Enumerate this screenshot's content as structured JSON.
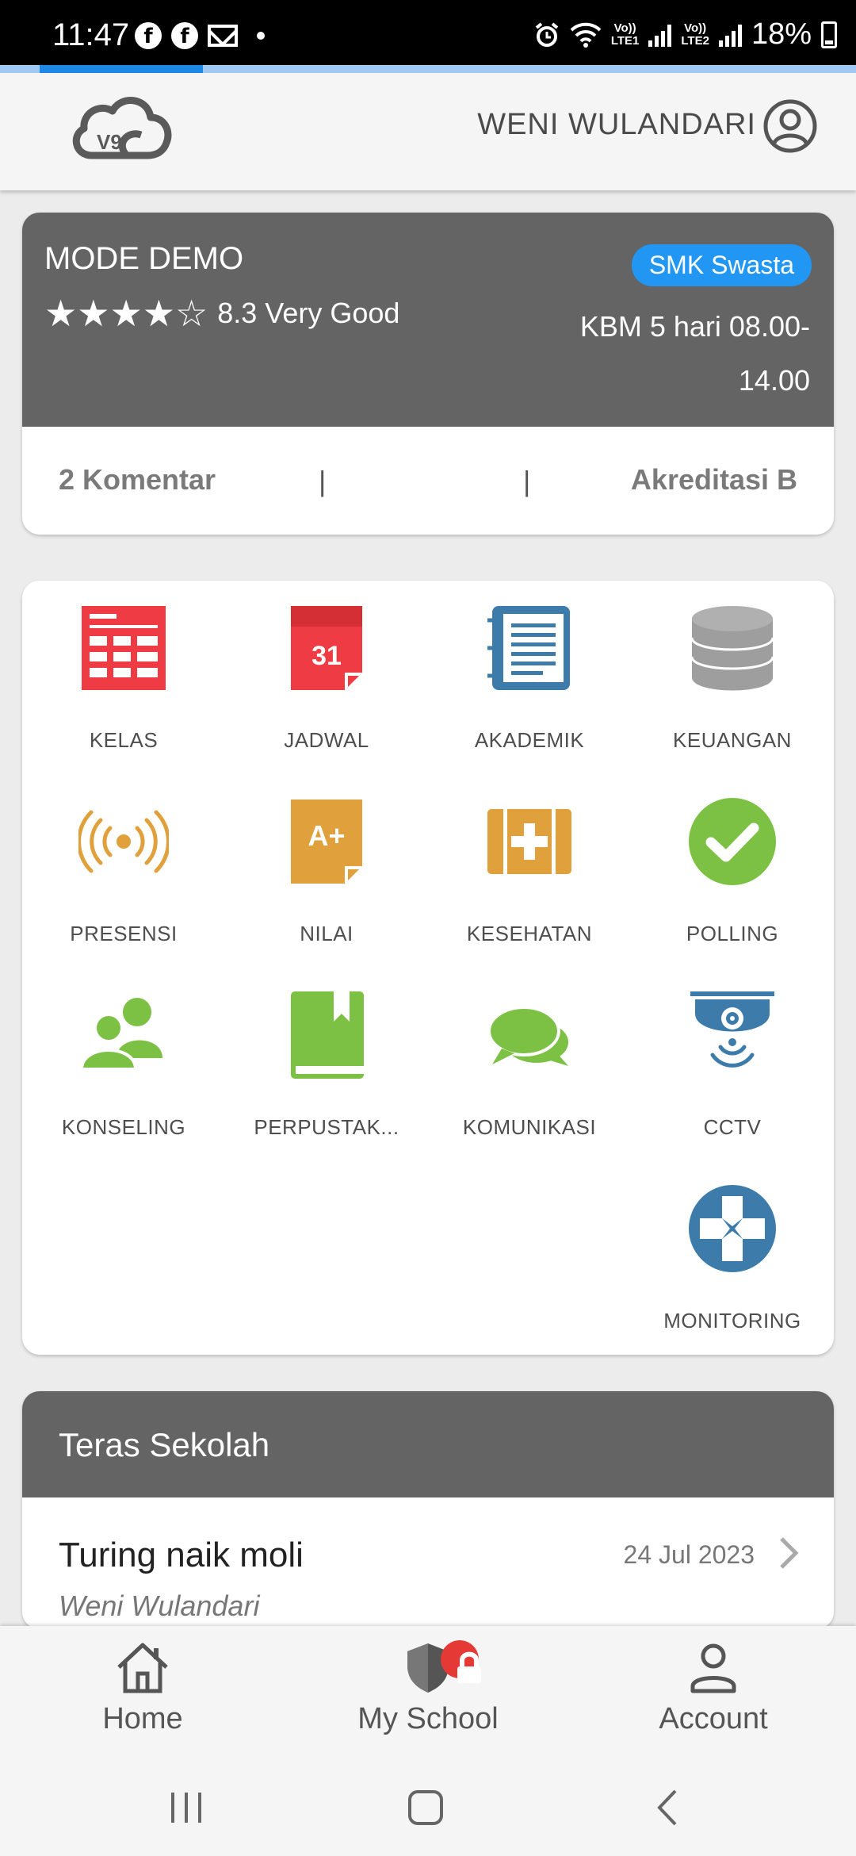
{
  "status_bar": {
    "time": "11:47",
    "battery": "18%",
    "sim1_label": "Vo))\nLTE1",
    "sim2_label": "Vo))\nLTE2"
  },
  "header": {
    "logo_text": "V9",
    "user_name": "WENI WULANDARI"
  },
  "school": {
    "name": "MODE DEMO",
    "rating_stars": 4,
    "rating_text": "8.3 Very Good",
    "badge": "SMK Swasta",
    "kbm": "KBM 5 hari 08.00-14.00",
    "comments": "2 Komentar",
    "separator": "|",
    "accreditation": "Akreditasi B"
  },
  "menu": [
    {
      "label": "KELAS",
      "icon": "calendar-grid-icon",
      "color": "#ef3b43"
    },
    {
      "label": "JADWAL",
      "icon": "calendar-31-icon",
      "color": "#ef3b43",
      "icon_text": "31"
    },
    {
      "label": "AKADEMIK",
      "icon": "notebook-icon",
      "color": "#3d7bab"
    },
    {
      "label": "KEUANGAN",
      "icon": "coins-stack-icon",
      "color": "#9e9e9e"
    },
    {
      "label": "PRESENSI",
      "icon": "broadcast-icon",
      "color": "#e0a03c"
    },
    {
      "label": "NILAI",
      "icon": "grade-document-icon",
      "color": "#e0a03c",
      "icon_text": "A+"
    },
    {
      "label": "KESEHATAN",
      "icon": "medical-kit-icon",
      "color": "#e0a03c"
    },
    {
      "label": "POLLING",
      "icon": "check-circle-icon",
      "color": "#7dc144"
    },
    {
      "label": "KONSELING",
      "icon": "people-icon",
      "color": "#7dc144"
    },
    {
      "label": "PERPUSTAK...",
      "icon": "book-icon",
      "color": "#7dc144"
    },
    {
      "label": "KOMUNIKASI",
      "icon": "chat-bubbles-icon",
      "color": "#7dc144"
    },
    {
      "label": "CCTV",
      "icon": "cctv-camera-icon",
      "color": "#3d7bab"
    },
    {
      "label": "MONITORING",
      "icon": "monitoring-dpad-icon",
      "color": "#3d7bab"
    }
  ],
  "teras": {
    "title": "Teras Sekolah",
    "post": {
      "title": "Turing naik moli",
      "date": "24 Jul 2023",
      "author": "Weni Wulandari"
    }
  },
  "bottom_nav": [
    {
      "label": "Home",
      "icon": "home-icon"
    },
    {
      "label": "My School",
      "icon": "shield-icon"
    },
    {
      "label": "Account",
      "icon": "person-icon"
    }
  ],
  "progress": {
    "fraction": 0.2
  }
}
